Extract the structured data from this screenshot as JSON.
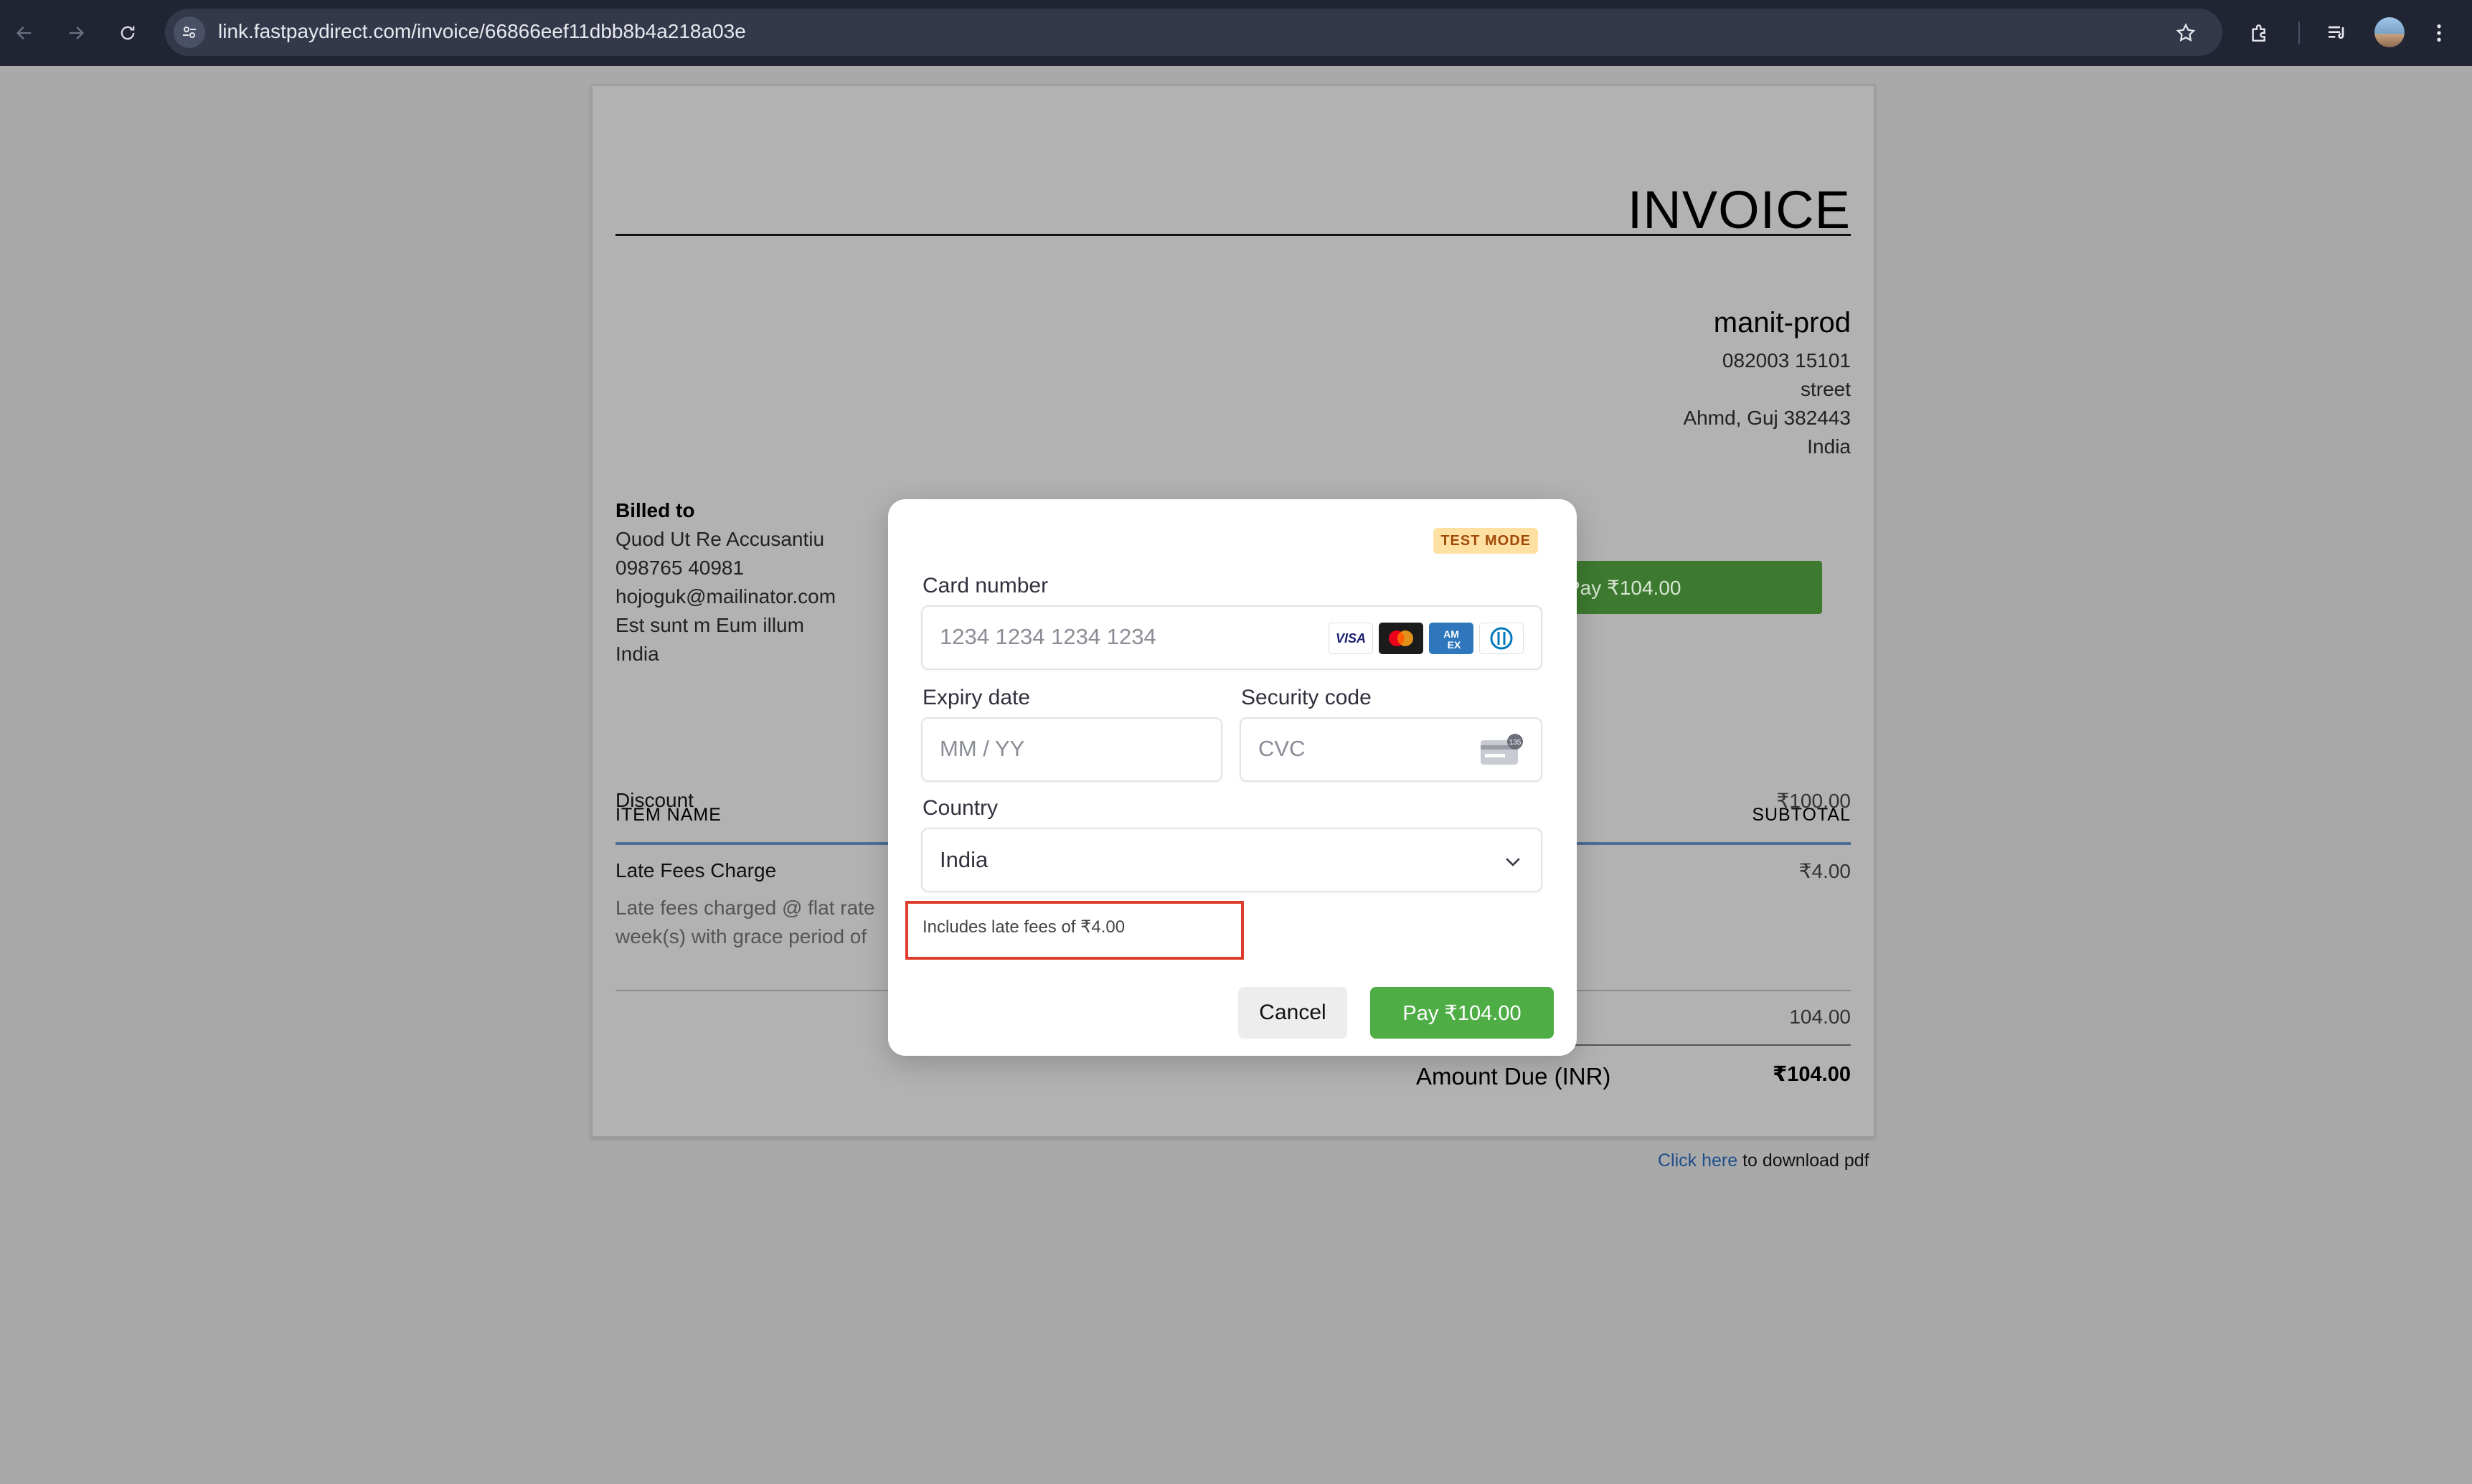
{
  "browser": {
    "url": "link.fastpaydirect.com/invoice/66866eef11dbb8b4a218a03e"
  },
  "invoice": {
    "title": "INVOICE",
    "company": {
      "name": "manit-prod",
      "phone": "082003 15101",
      "street": "street",
      "city": "Ahmd, Guj 382443",
      "country": "India"
    },
    "billed_to": {
      "header": "Billed to",
      "name": "Quod Ut Re Accusantiu",
      "phone": "098765 40981",
      "email": "hojoguk@mailinator.com",
      "address": "Est sunt m Eum illum",
      "country": "India"
    },
    "pay_button_label": "Pay ₹104.00",
    "table": {
      "col_item": "ITEM NAME",
      "col_subtotal": "SUBTOTAL",
      "rows": [
        {
          "name": "Discount",
          "subtotal": "₹100.00"
        },
        {
          "name": "Late Fees Charge",
          "subtotal": "₹4.00",
          "description_line1": "Late fees charged @ flat rate",
          "description_line2": "week(s) with grace period of"
        }
      ]
    },
    "total": "104.00",
    "amount_due_label": "Amount Due (INR)",
    "amount_due_value": "₹104.00",
    "download": {
      "link_text": "Click here",
      "suffix": " to download pdf"
    }
  },
  "modal": {
    "badge": "TEST MODE",
    "card_number_label": "Card number",
    "card_number_placeholder": "1234 1234 1234 1234",
    "expiry_label": "Expiry date",
    "expiry_placeholder": "MM / YY",
    "security_label": "Security code",
    "security_placeholder": "CVC",
    "country_label": "Country",
    "country_value": "India",
    "late_fee_note": "Includes late fees of ₹4.00",
    "cancel_label": "Cancel",
    "pay_label": "Pay ₹104.00",
    "card_brands": [
      "visa-icon",
      "mastercard-icon",
      "amex-icon",
      "diners-icon"
    ]
  }
}
